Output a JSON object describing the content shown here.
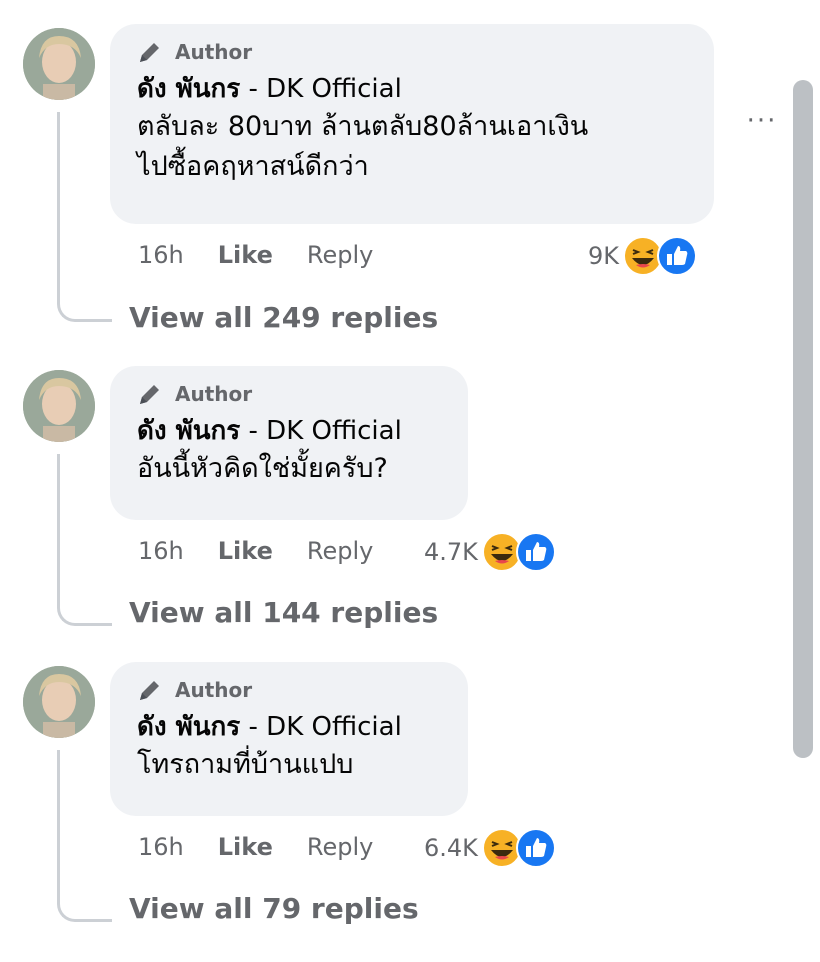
{
  "ui": {
    "more_options": "···"
  },
  "comments": [
    {
      "author_badge": "Author",
      "name_thai": "ดัง พันกร",
      "name_suffix": " - DK Official",
      "text_lines": [
        "ตลับละ 80บาท ล้านตลับ80ล้านเอาเงิน",
        "ไปซื้อคฤหาสน์ดีกว่า"
      ],
      "time": "16h",
      "like": "Like",
      "reply": "Reply",
      "reactions": "9K",
      "view_replies": "View all 249 replies"
    },
    {
      "author_badge": "Author",
      "name_thai": "ดัง พันกร",
      "name_suffix": " - DK Official",
      "text_lines": [
        "อันนี้หัวคิดใช่มั้ยครับ?"
      ],
      "time": "16h",
      "like": "Like",
      "reply": "Reply",
      "reactions": "4.7K",
      "view_replies": "View all 144 replies"
    },
    {
      "author_badge": "Author",
      "name_thai": "ดัง พันกร",
      "name_suffix": " - DK Official",
      "text_lines": [
        "โทรถามที่บ้านแปบ"
      ],
      "time": "16h",
      "like": "Like",
      "reply": "Reply",
      "reactions": "6.4K",
      "view_replies": "View all 79 replies"
    }
  ],
  "colors": {
    "bubble": "#f0f2f5",
    "meta_text": "#65676b",
    "like_blue": "#1877f2",
    "haha_yellow": "#f7b125"
  }
}
